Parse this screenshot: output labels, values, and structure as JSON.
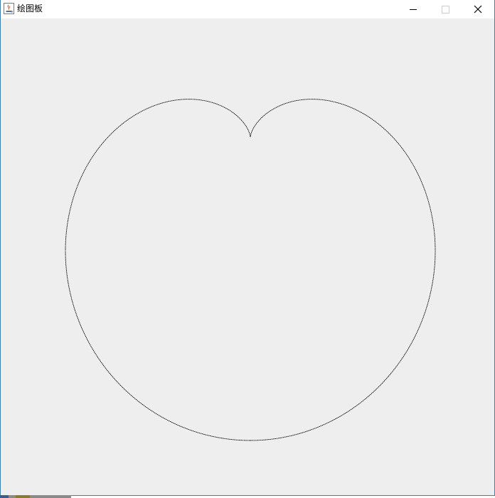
{
  "window": {
    "title": "绘图板",
    "icon": "java-app-icon",
    "controls": {
      "minimize_icon": "minimize-icon",
      "maximize_icon": "maximize-icon",
      "close_icon": "close-icon"
    }
  },
  "canvas": {
    "background": "#eeeeee",
    "shape": "cardioid",
    "stroke_color": "#000000"
  },
  "colors": {
    "window_border": "#3c7fb1",
    "titlebar_bg": "#ffffff",
    "disabled_control": "#cccccc"
  }
}
